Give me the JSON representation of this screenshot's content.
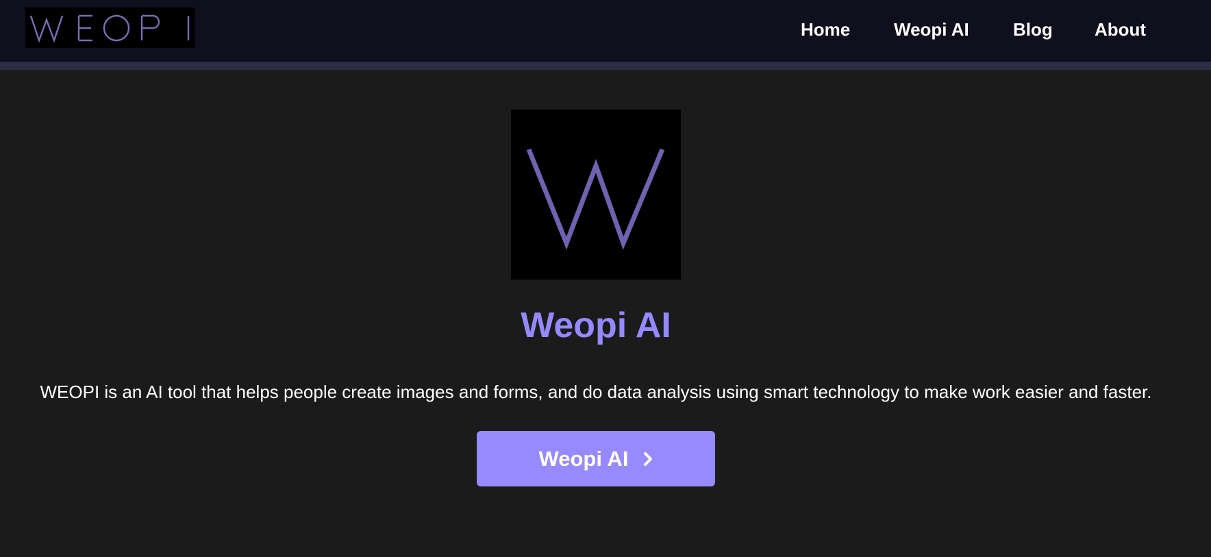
{
  "brand": {
    "logo_text": "WEOPI",
    "logo_color": "#7a6cb8",
    "hero_logo_text": "W"
  },
  "nav": {
    "items": [
      {
        "label": "Home"
      },
      {
        "label": "Weopi AI"
      },
      {
        "label": "Blog"
      },
      {
        "label": "About"
      }
    ]
  },
  "hero": {
    "title": "Weopi AI",
    "description": "WEOPI is an AI tool that helps people create images and forms, and do data analysis using smart technology to make work easier and faster.",
    "cta_label": "Weopi AI",
    "cta_icon": "chevron-right-icon"
  },
  "colors": {
    "accent": "#978aff",
    "title": "#9688ff",
    "header_bg": "#0f0f1d",
    "page_bg": "#1b1b1b"
  }
}
